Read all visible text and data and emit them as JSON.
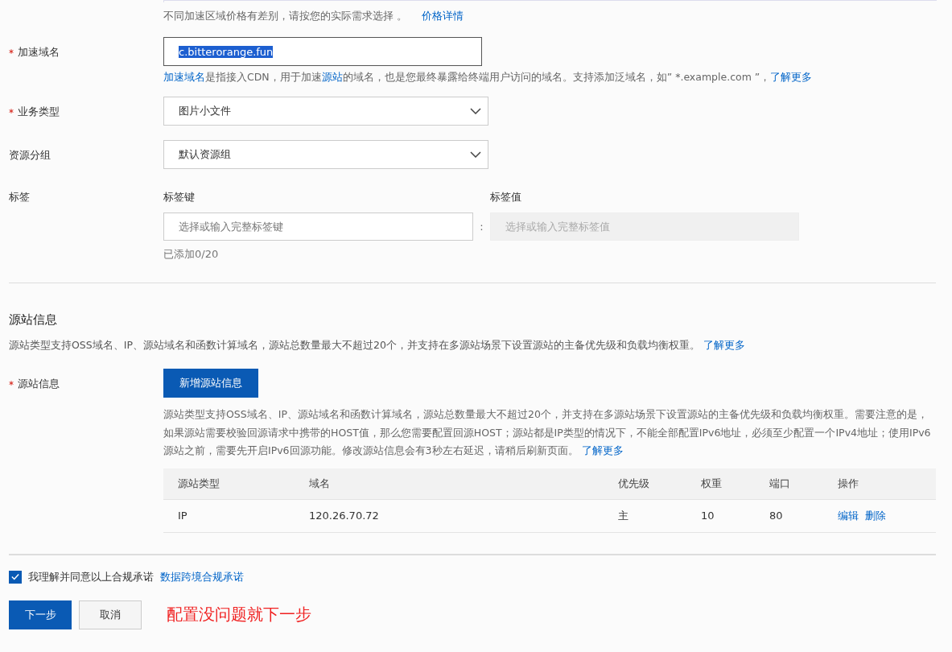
{
  "price_note": {
    "text": "不同加速区域价格有差别，请按您的实际需求选择 。",
    "link": "价格详情"
  },
  "fields": [
    {
      "kind": "text",
      "label": "加速域名",
      "required": true,
      "value": "c.bitterorange.fun",
      "value_selected": true,
      "help": [
        {
          "text": "加速域名",
          "link": true
        },
        {
          "text": "是指接入CDN，用于加速",
          "link": false
        },
        {
          "text": "源站",
          "link": true
        },
        {
          "text": "的域名，也是您最终暴露给终端用户访问的域名。支持添加泛域名，如” *.example.com ”，",
          "link": false
        },
        {
          "text": "了解更多",
          "link": true
        }
      ]
    },
    {
      "kind": "select",
      "label": "业务类型",
      "required": true,
      "value": "图片小文件"
    },
    {
      "kind": "select",
      "label": "资源分组",
      "required": false,
      "value": "默认资源组"
    },
    {
      "kind": "tags",
      "label": "标签",
      "required": false,
      "key_label": "标签键",
      "value_label": "标签值",
      "key_placeholder": "选择或输入完整标签键",
      "value_placeholder": "选择或输入完整标签值",
      "value_disabled": true,
      "separator": ":",
      "count": "已添加0/20"
    }
  ],
  "origin_section": {
    "title": "源站信息",
    "description": "源站类型支持OSS域名、IP、源站域名和函数计算域名，源站总数量最大不超过20个，并支持在多源站场景下设置源站的主备优先级和负载均衡权重。",
    "link": "了解更多",
    "field": {
      "label": "源站信息",
      "required": true,
      "button": "新增源站信息",
      "note": "源站类型支持OSS域名、IP、源站域名和函数计算域名，源站总数量最大不超过20个，并支持在多源站场景下设置源站的主备优先级和负载均衡权重。需要注意的是，如果源站需要校验回源请求中携带的HOST值，那么您需要配置回源HOST；源站都是IP类型的情况下，不能全部配置IPv6地址，必须至少配置一个IPv4地址；使用IPv6源站之前，需要先开启IPv6回源功能。修改源站信息会有3秒左右延迟，请稍后刷新页面。",
      "note_link": "了解更多",
      "table": {
        "columns": [
          "源站类型",
          "域名",
          "优先级",
          "权重",
          "端口",
          "操作"
        ],
        "rows": [
          {
            "cells": [
              "IP",
              "120.26.70.72",
              "主",
              "10",
              "80"
            ],
            "actions": [
              "编辑",
              "删除"
            ]
          }
        ]
      }
    }
  },
  "agreement": {
    "checked": true,
    "text": "我理解并同意以上合规承诺",
    "link": "数据跨境合规承诺"
  },
  "buttons": [
    {
      "label": "下一步",
      "primary": true
    },
    {
      "label": "取消",
      "primary": false
    }
  ],
  "annotation": "配置没问题就下一步"
}
